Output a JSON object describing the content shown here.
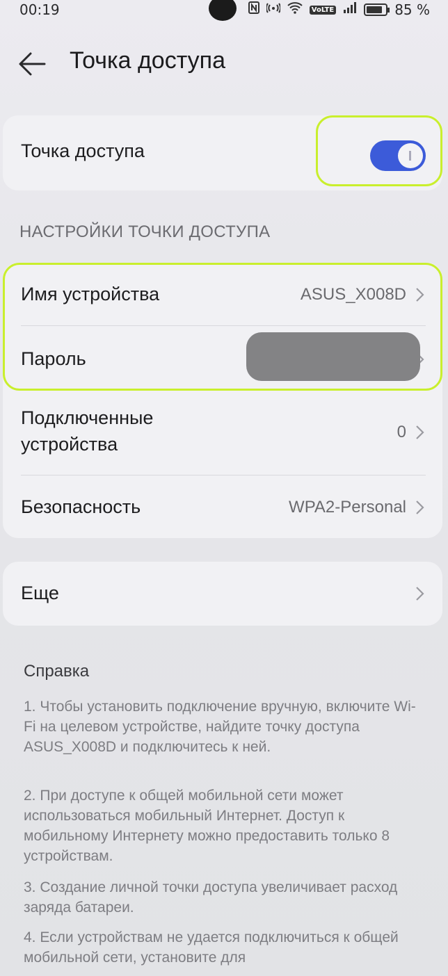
{
  "status_bar": {
    "time": "00:19",
    "icons": [
      "nfc-icon",
      "hotspot-icon",
      "wifi-icon",
      "volte-icon",
      "signal-icon",
      "battery-icon"
    ],
    "volte_label": "VoLTE",
    "battery_percent": "85 %",
    "battery_level": 0.85
  },
  "header": {
    "title": "Точка доступа"
  },
  "hotspot_toggle": {
    "label": "Точка доступа",
    "enabled": true,
    "accent_color": "#3c5bd9"
  },
  "settings": {
    "section_title": "НАСТРОЙКИ ТОЧКИ ДОСТУПА",
    "device_name_label": "Имя устройства",
    "device_name_value": "ASUS_X008D",
    "password_label": "Пароль",
    "connected_label_line1": "Подключенные",
    "connected_label_line2": "устройства",
    "connected_value": "0",
    "security_label": "Безопасность",
    "security_value": "WPA2-Personal"
  },
  "more": {
    "label": "Еще"
  },
  "help": {
    "title": "Справка",
    "items": [
      "1. Чтобы установить подключение вручную, включите Wi-Fi на целевом устройстве, найдите точку доступа ASUS_X008D и подключитесь к ней.",
      "2. При доступе к общей мобильной сети может использоваться мобильный Интернет. Доступ к мобильному Интернету можно предоставить только 8 устройствам.",
      "3. Создание личной точки доступа увеличивает расход заряда батареи.",
      "4. Если устройствам не удается подключиться к общей мобильной сети, установите для"
    ]
  },
  "colors": {
    "highlight": "#c9ef2d",
    "redaction": "#838385"
  }
}
